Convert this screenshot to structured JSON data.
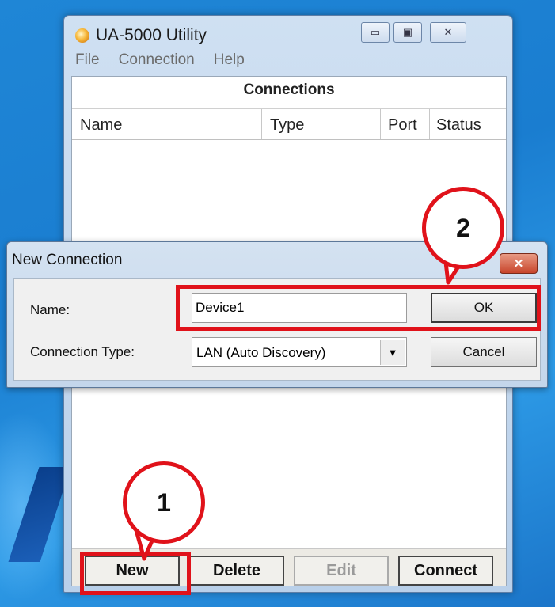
{
  "main_window": {
    "title": "UA-5000 Utility",
    "controls": {
      "minimize": "▭",
      "maximize": "▣",
      "close": "✕"
    },
    "menu": [
      "File",
      "Connection",
      "Help"
    ],
    "heading": "Connections",
    "columns": [
      "Name",
      "Type",
      "Port",
      "Status"
    ],
    "buttons": {
      "new": "New",
      "delete": "Delete",
      "edit": "Edit",
      "connect": "Connect"
    }
  },
  "dialog": {
    "title": "New Connection",
    "close": "✕",
    "name_label": "Name:",
    "name_value": "Device1",
    "type_label": "Connection Type:",
    "type_value": "LAN (Auto Discovery)",
    "ok": "OK",
    "cancel": "Cancel"
  },
  "callouts": {
    "step1": "1",
    "step2": "2"
  },
  "colors": {
    "highlight": "#e0121a",
    "desktop": "#1f86d6"
  },
  "icons": {
    "app": "app-icon",
    "dropdown": "chevron-down-icon"
  }
}
